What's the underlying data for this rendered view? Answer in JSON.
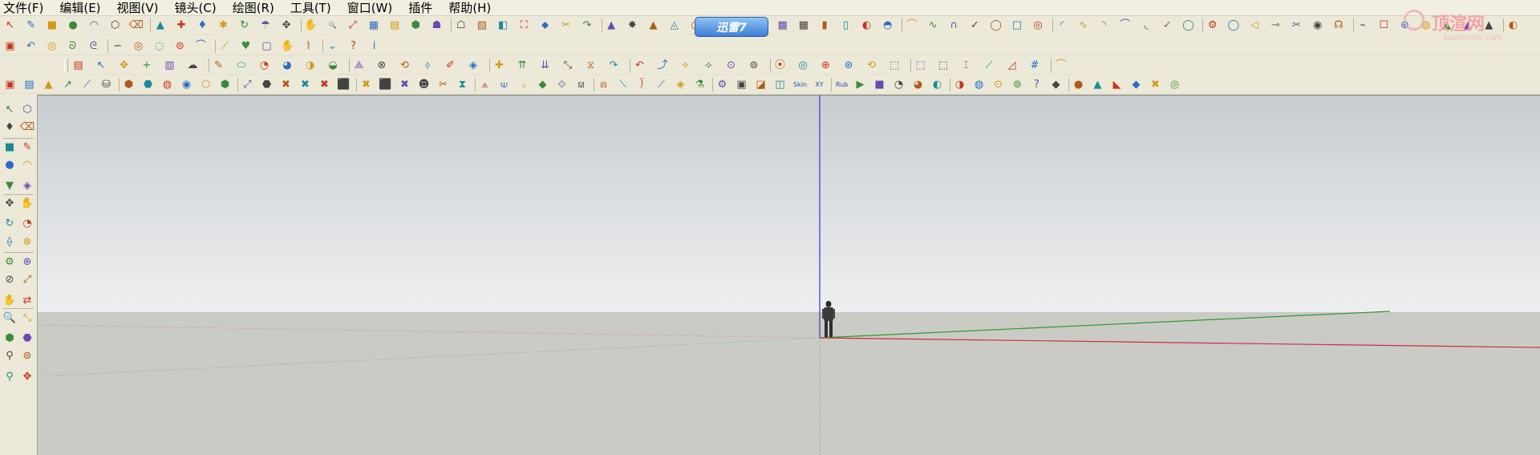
{
  "menu": [
    "文件(F)",
    "编辑(E)",
    "视图(V)",
    "镜头(C)",
    "绘图(R)",
    "工具(T)",
    "窗口(W)",
    "插件",
    "帮助(H)"
  ],
  "badge": "迅雷7",
  "watermark": "顶渲网",
  "watermark_sub": "toprender.com",
  "toolbar_icons": {
    "row1": [
      "↖",
      "✎",
      "■",
      "●",
      "◠",
      "⬡",
      "⌫",
      "▲",
      "✚",
      "♦",
      "✱",
      "↻",
      "☂",
      "✥",
      "✋",
      "🔍",
      "⤢",
      "▦",
      "▤",
      "⬢",
      "☗",
      "☖",
      "▧",
      "◧",
      "⛶",
      "⬥",
      "✂",
      "↷",
      "▲",
      "✸",
      "▲",
      "◬",
      "◔",
      "◑",
      "▣",
      "▥",
      "▩",
      "▦",
      "▮",
      "▯",
      "◐",
      "◓",
      "⌒",
      "∿",
      "∩",
      "✓",
      "◯",
      "□",
      "◎",
      "◜",
      "∿",
      "◝",
      "⌒",
      "◟",
      "✓",
      "◯",
      "⚙",
      "◯",
      "◁",
      "⊸",
      "✂",
      "◉",
      "☊",
      "⌁",
      "☐",
      "⊕",
      "◍",
      "▲",
      "▲",
      "▲",
      "◐"
    ],
    "row2": [
      "▣",
      "↶",
      "◎",
      "ᘐ",
      "ᘓ",
      "∽",
      "◎",
      "◌",
      "⊜",
      "⌒",
      "⟋",
      "♥",
      "▢",
      "✋",
      "⌇",
      "⌄",
      "?",
      "i"
    ],
    "row3": [
      "▤",
      "↖",
      "✥",
      "+",
      "▥",
      "☁",
      "✎",
      "⬭",
      "◔",
      "◕",
      "◑",
      "◒",
      "⟁",
      "⊗",
      "⟲",
      "⬨",
      "✐",
      "◈",
      "✚",
      "⇈",
      "⇊",
      "⤡",
      "⧖",
      "↷",
      "↶",
      "⤴",
      "⟡",
      "⟢",
      "⊙",
      "⊚",
      "⦿",
      "◎",
      "⊕",
      "⊛",
      "⟲",
      "⬚",
      "⬚",
      "⬚",
      "⌶",
      "⟋",
      "◿",
      "#",
      "⌒"
    ],
    "row4": [
      "▣",
      "▤",
      "▲",
      "↗",
      "⟋",
      "⛁",
      "⬢",
      "⬣",
      "◍",
      "◉",
      "⬡",
      "⬢",
      "⤢",
      "⬣",
      "✖",
      "✖",
      "✖",
      "⬛",
      "✖",
      "⬛",
      "✖",
      "☻",
      "✂",
      "⧗",
      "⟑",
      "⟒",
      "⟓",
      "◆",
      "⟐",
      "⟏",
      "⟎",
      "⟍",
      "⟌",
      "⟋",
      "◈",
      "⚗",
      "⚙",
      "▣",
      "◪",
      "◫",
      "Skin",
      "XY",
      "Rub",
      "▶",
      "■",
      "◔",
      "◕",
      "◐",
      "◑",
      "◍",
      "⊙",
      "⊚",
      "?",
      "◆",
      "●",
      "▲",
      "◣",
      "◆",
      "✖",
      "◎"
    ]
  },
  "left_icons": [
    "↖",
    "⬡",
    "♦",
    "⌫",
    "■",
    "✎",
    "●",
    "◠",
    "▼",
    "◈",
    "✥",
    "✋",
    "↻",
    "◔",
    "⟠",
    "⊗",
    "⚙",
    "⊕",
    "⊘",
    "⤢",
    "✋",
    "⇄",
    "🔍",
    "⤡",
    "⬢",
    "⬣",
    "⚲",
    "⊚",
    "⚲",
    "✥"
  ]
}
